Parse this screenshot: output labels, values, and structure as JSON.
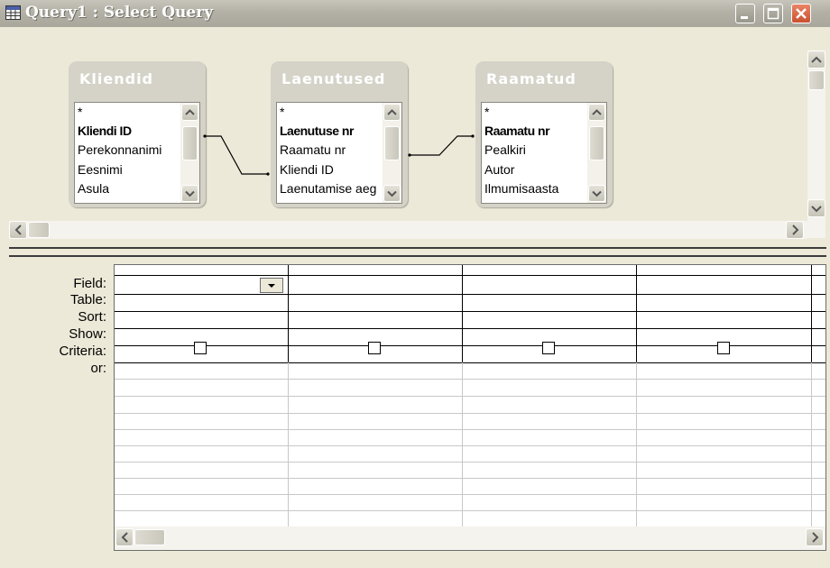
{
  "window": {
    "title": "Query1 : Select Query",
    "icon": "query-design-icon",
    "controls": [
      "minimize-icon",
      "maximize-icon",
      "close-icon"
    ]
  },
  "tables": [
    {
      "name": "Kliendid",
      "fields": [
        {
          "label": "*",
          "key": false
        },
        {
          "label": "Kliendi ID",
          "key": true
        },
        {
          "label": "Perekonnanimi",
          "key": false
        },
        {
          "label": "Eesnimi",
          "key": false
        },
        {
          "label": "Asula",
          "key": false
        }
      ]
    },
    {
      "name": "Laenutused",
      "fields": [
        {
          "label": "*",
          "key": false
        },
        {
          "label": "Laenutuse nr",
          "key": true
        },
        {
          "label": "Raamatu nr",
          "key": false
        },
        {
          "label": "Kliendi ID",
          "key": false
        },
        {
          "label": "Laenutamise aeg",
          "key": false
        }
      ]
    },
    {
      "name": "Raamatud",
      "fields": [
        {
          "label": "*",
          "key": false
        },
        {
          "label": "Raamatu nr",
          "key": true
        },
        {
          "label": "Pealkiri",
          "key": false
        },
        {
          "label": "Autor",
          "key": false
        },
        {
          "label": "Ilmumisaasta",
          "key": false
        }
      ]
    }
  ],
  "relationships": [
    {
      "from": "Kliendid.Kliendi ID",
      "to": "Laenutused.Kliendi ID"
    },
    {
      "from": "Laenutused.Raamatu nr",
      "to": "Raamatud.Raamatu nr"
    }
  ],
  "grid": {
    "row_labels": [
      "Field:",
      "Table:",
      "Sort:",
      "Show:",
      "Criteria:",
      "or:"
    ],
    "columns": 4,
    "show_checkboxes": [
      false,
      false,
      false,
      false
    ]
  },
  "colors": {
    "titlebar": "#b3b1a6",
    "background": "#ece9d8",
    "close_button": "#d9603e"
  }
}
